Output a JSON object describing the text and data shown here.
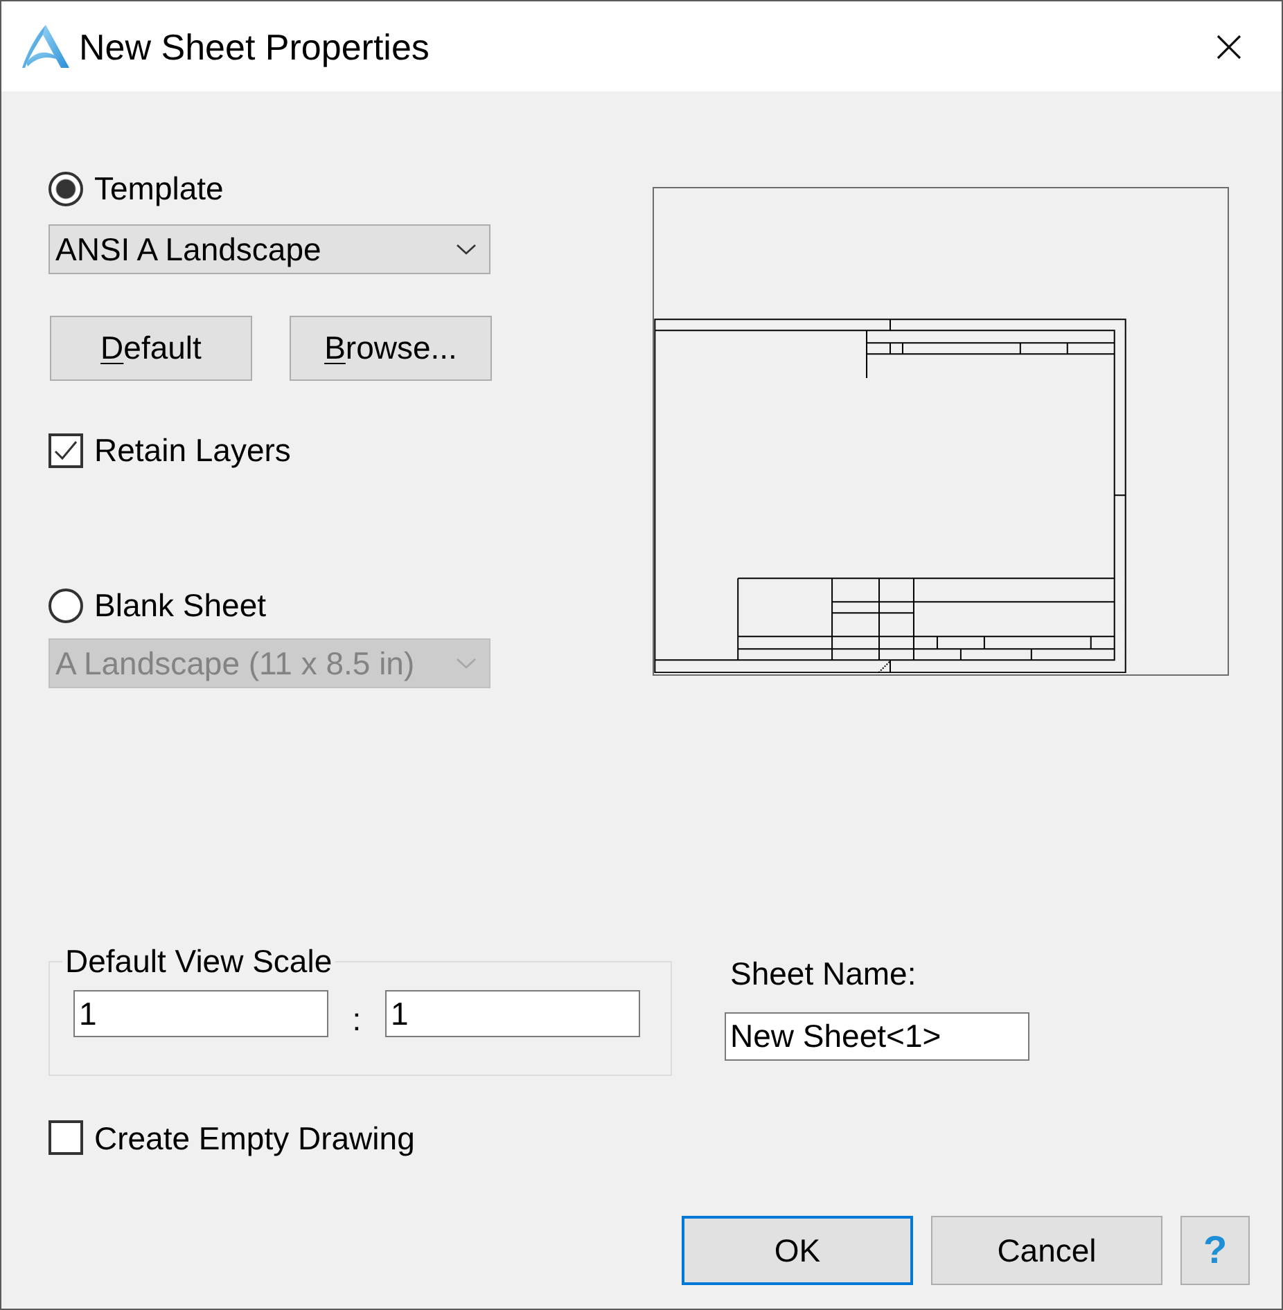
{
  "window": {
    "title": "New Sheet Properties"
  },
  "source": {
    "options": [
      {
        "kind": "template",
        "label": "Template",
        "selected": true,
        "dropdown": {
          "value": "ANSI A Landscape",
          "disabled": false
        },
        "buttons": [
          {
            "label": "Default",
            "mnemonic": true
          },
          {
            "label": "Browse...",
            "mnemonic": true
          }
        ],
        "checkbox": {
          "label": "Retain Layers",
          "checked": true
        }
      },
      {
        "kind": "blank",
        "label": "Blank Sheet",
        "selected": false,
        "dropdown": {
          "value": "A Landscape (11 x 8.5 in)",
          "disabled": true
        }
      }
    ]
  },
  "view_scale": {
    "label": "Default View Scale",
    "numerator": "1",
    "separator": ":",
    "denominator": "1"
  },
  "sheet_name": {
    "label": "Sheet Name:",
    "value": "New Sheet<1>"
  },
  "create_empty_drawing": {
    "label": "Create Empty Drawing",
    "checked": false
  },
  "buttons": [
    {
      "kind": "text",
      "label": "OK",
      "focused": true
    },
    {
      "kind": "text",
      "label": "Cancel",
      "focused": false
    },
    {
      "kind": "help",
      "label": "?",
      "focused": false
    }
  ]
}
